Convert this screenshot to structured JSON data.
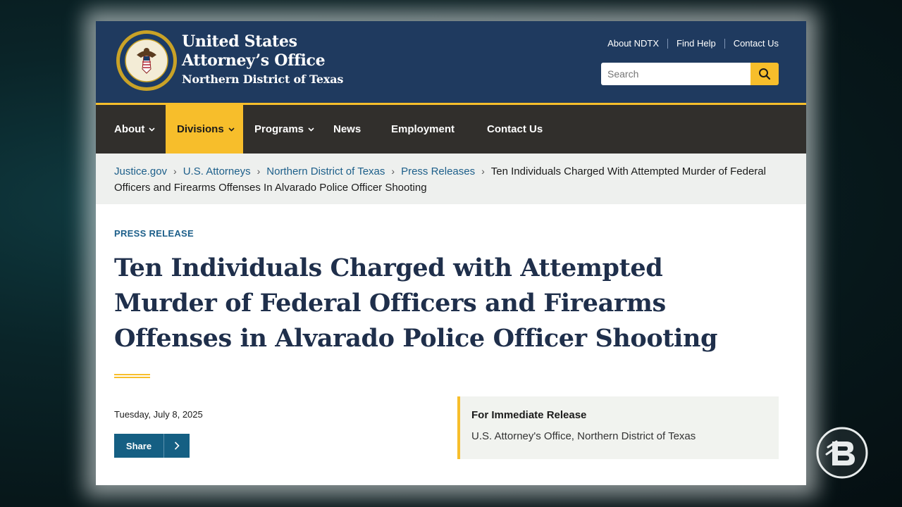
{
  "header": {
    "agency_line1": "United States",
    "agency_line2": "Attorney’s Office",
    "agency_line3": "Northern District of Texas",
    "seal": "department-of-justice-seal",
    "utility_links": [
      "About NDTX",
      "Find Help",
      "Contact Us"
    ],
    "search_placeholder": "Search"
  },
  "nav": {
    "items": [
      {
        "label": "About",
        "has_dropdown": true,
        "active": false
      },
      {
        "label": "Divisions",
        "has_dropdown": true,
        "active": true
      },
      {
        "label": "Programs",
        "has_dropdown": true,
        "active": false
      },
      {
        "label": "News",
        "has_dropdown": false,
        "active": false
      },
      {
        "label": "Employment",
        "has_dropdown": false,
        "active": false
      },
      {
        "label": "Contact Us",
        "has_dropdown": false,
        "active": false
      }
    ]
  },
  "breadcrumb": {
    "links": [
      "Justice.gov",
      "U.S. Attorneys",
      "Northern District of Texas",
      "Press Releases"
    ],
    "current": "Ten Individuals Charged With Attempted Murder of Federal Officers and Firearms Offenses In Alvarado Police Officer Shooting"
  },
  "article": {
    "kicker": "PRESS RELEASE",
    "title": "Ten Individuals Charged with Attempted Murder of Federal Officers and Firearms Offenses in Alvarado Police Officer Shooting",
    "date": "Tuesday, July 8, 2025",
    "share_label": "Share",
    "release_heading": "For Immediate Release",
    "release_source": "U.S. Attorney's Office, Northern District of Texas"
  },
  "colors": {
    "header_bg": "#1f3a5f",
    "accent_gold": "#f7be2b",
    "nav_bg": "#312f2c",
    "link_blue": "#1d5f8a",
    "title_navy": "#1f2f4b"
  }
}
